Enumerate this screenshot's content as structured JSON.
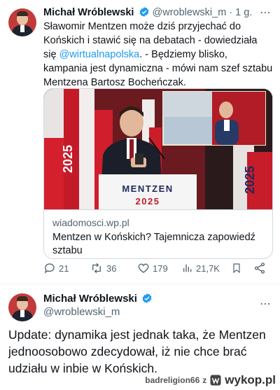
{
  "tweet1": {
    "author_name": "Michał Wróblewski",
    "handle_time": "@wroblewski_m · 1 g.",
    "text_before": "Sławomir Mentzen może dziś przyjechać do Końskich i stawić się na debatach - dowiedziała się ",
    "mention": "@wirtualnapolska",
    "text_after": ". - Będziemy blisko, kampania jest dynamiczna - mówi nam szef sztabu Mentzena Bartosz Bocheńczak.",
    "card": {
      "image_sign_line1": "MENTZEN",
      "image_sign_line2": "2025",
      "domain": "wiadomosci.wp.pl",
      "title": "Mentzen w Końskich? Tajemnicza zapowiedź sztabu"
    },
    "stats": {
      "replies": "21",
      "reposts": "36",
      "likes": "179",
      "views": "21,7K"
    }
  },
  "tweet2": {
    "author_name": "Michał Wróblewski",
    "handle": "@wroblewski_m",
    "text": "Update: dynamika jest jednak taka, że Mentzen jednoosobowo zdecydował, iż nie chce brać udziału w inbie w Końskich."
  },
  "watermark": {
    "user": "badreligion66",
    "sep": "z",
    "site": "wykop.pl"
  },
  "colors": {
    "accent": "#1d9bf0",
    "secondary_text": "#536471",
    "border": "#cfd9de"
  }
}
